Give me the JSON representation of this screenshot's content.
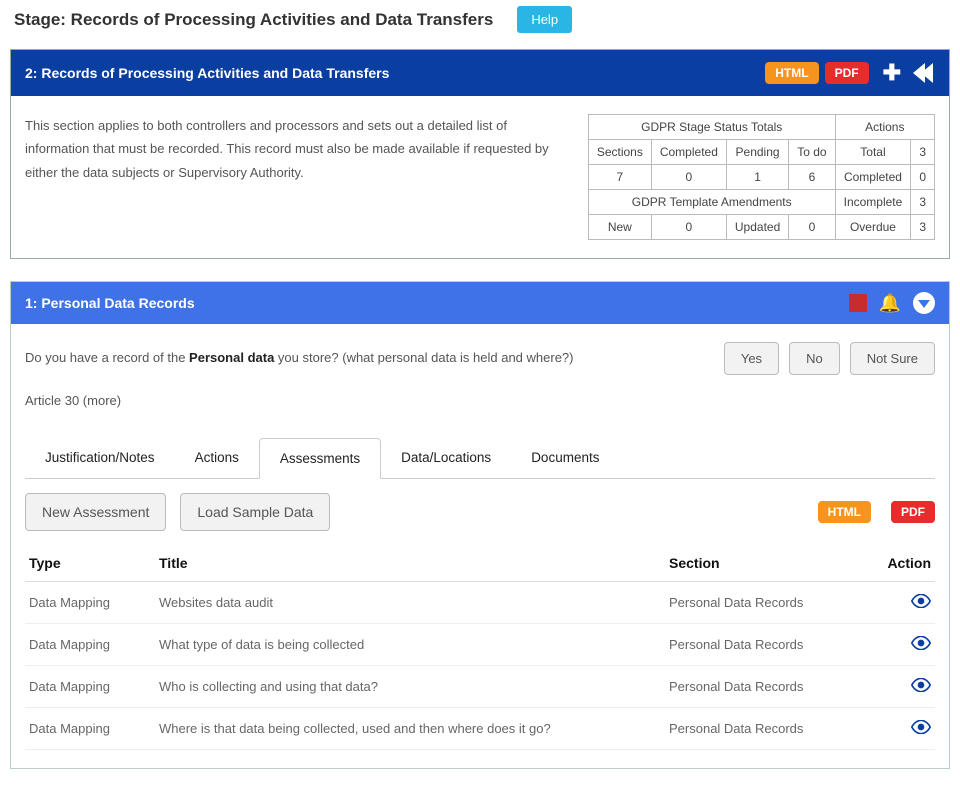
{
  "header": {
    "stage_label": "Stage: Records of Processing Activities and Data Transfers",
    "help": "Help"
  },
  "panel2": {
    "title": "2: Records of Processing Activities and Data Transfers",
    "html_btn": "HTML",
    "pdf_btn": "PDF",
    "desc": "This section applies to both controllers and processors and sets out a detailed list of information that must be recorded.  This record must also be made available if requested by either the data subjects or Supervisory Authority.",
    "status": {
      "heading_totals": "GDPR Stage Status Totals",
      "heading_actions": "Actions",
      "cols": {
        "sections": "Sections",
        "completed": "Completed",
        "pending": "Pending",
        "todo": "To do"
      },
      "vals": {
        "sections": "7",
        "completed": "0",
        "pending": "1",
        "todo": "6"
      },
      "amend": "GDPR Template Amendments",
      "new": "New",
      "new_v": "0",
      "updated": "Updated",
      "updated_v": "0",
      "actions": {
        "total": "Total",
        "total_v": "3",
        "completed": "Completed",
        "completed_v": "0",
        "incomplete": "Incomplete",
        "incomplete_v": "3",
        "overdue": "Overdue",
        "overdue_v": "3"
      }
    }
  },
  "panel1": {
    "title": "1: Personal Data Records",
    "q_pre": "Do you have a record of the ",
    "q_bold": "Personal data",
    "q_post": " you store? (what personal data is held and where?)",
    "yes": "Yes",
    "no": "No",
    "notsure": "Not Sure",
    "article": "Article 30 (more)",
    "tabs": {
      "t0": "Justification/Notes",
      "t1": "Actions",
      "t2": "Assessments",
      "t3": "Data/Locations",
      "t4": "Documents"
    },
    "new_assessment": "New Assessment",
    "load_sample": "Load Sample Data",
    "html_btn": "HTML",
    "pdf_btn": "PDF",
    "cols": {
      "type": "Type",
      "title": "Title",
      "section": "Section",
      "action": "Action"
    },
    "rows": [
      {
        "type": "Data Mapping",
        "title": "Websites data audit",
        "section": "Personal Data Records"
      },
      {
        "type": "Data Mapping",
        "title": "What type of data is being collected",
        "section": "Personal Data Records"
      },
      {
        "type": "Data Mapping",
        "title": "Who is collecting and using that data?",
        "section": "Personal Data Records"
      },
      {
        "type": "Data Mapping",
        "title": "Where is that data being collected, used and then where does it go?",
        "section": "Personal Data Records"
      }
    ]
  }
}
